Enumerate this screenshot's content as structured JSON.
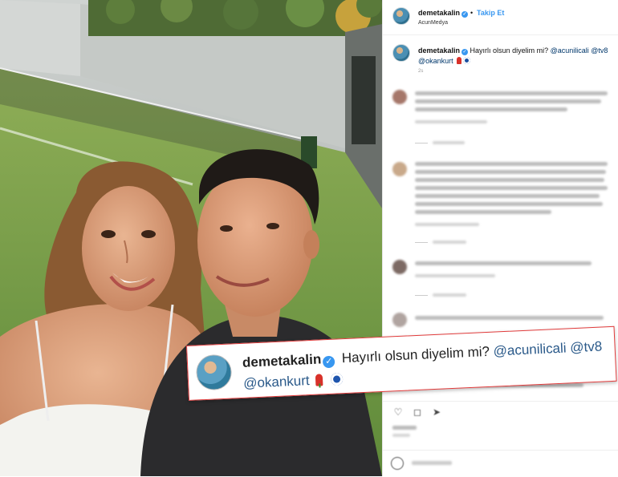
{
  "post": {
    "username": "demetakalin",
    "follow_label": "Takip Et",
    "separator": "•",
    "location": "AcunMedya"
  },
  "caption": {
    "username": "demetakalin",
    "text": "Hayırlı olsun diyelim mi?",
    "mention_1": "@acunilicali",
    "mention_2": "@tv8",
    "mention_3": "@okankurt",
    "time": "2s"
  },
  "callout": {
    "username": "demetakalin",
    "text": "Hayırlı olsun diyelim mi?",
    "mention_1": "@acunilicali",
    "mention_2": "@tv8",
    "mention_3": "@okankurt"
  },
  "colors": {
    "verified": "#3897f0",
    "follow": "#3897f0",
    "mention": "#00376b",
    "callout_border": "#e03a3a"
  },
  "icons": [
    "heart-icon",
    "comment-icon",
    "share-icon",
    "emoji-icon",
    "verified-icon"
  ]
}
